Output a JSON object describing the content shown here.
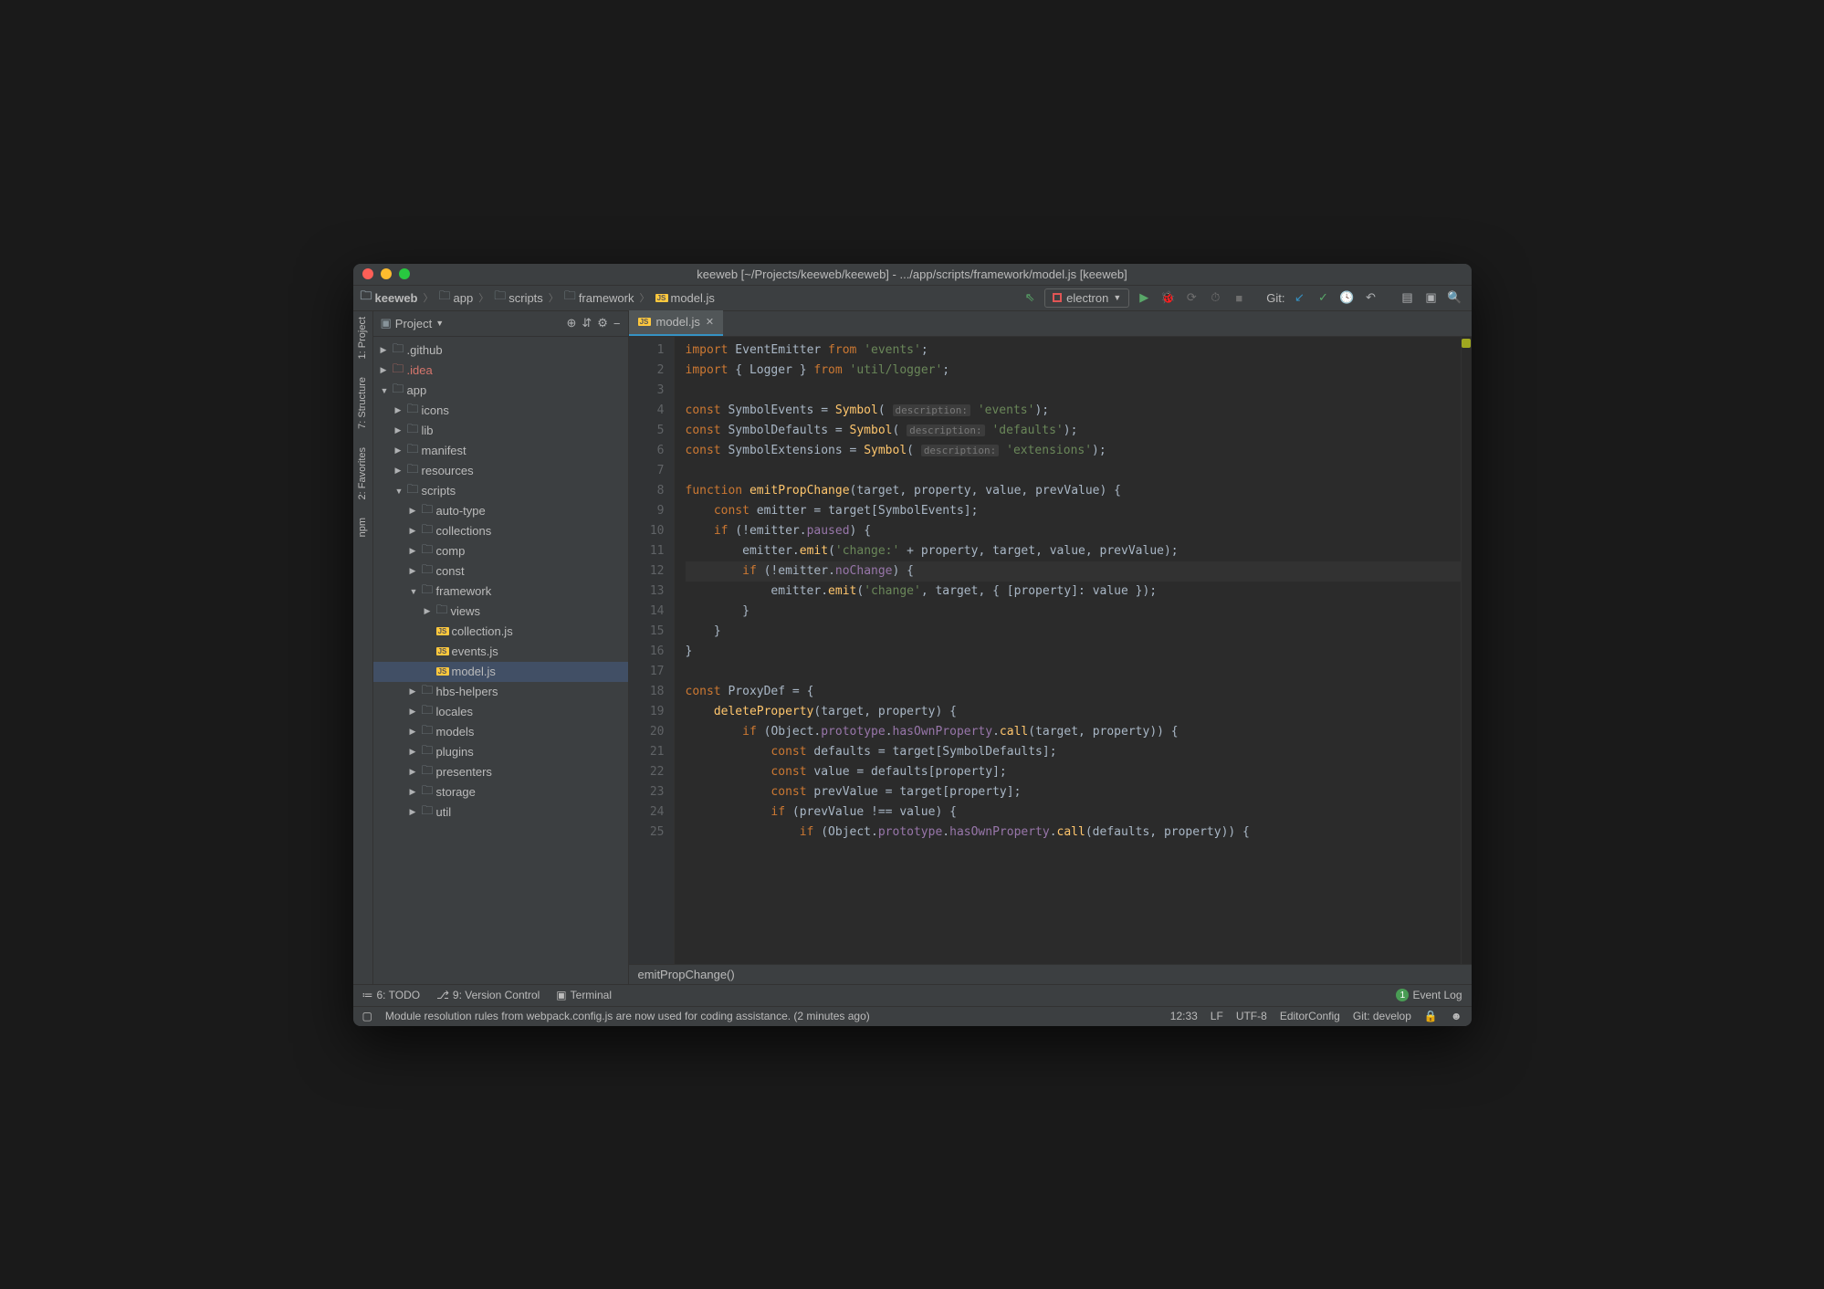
{
  "window": {
    "title": "keeweb [~/Projects/keeweb/keeweb] - .../app/scripts/framework/model.js [keeweb]"
  },
  "breadcrumbs": [
    {
      "label": "keeweb",
      "bold": true
    },
    {
      "label": "app"
    },
    {
      "label": "scripts"
    },
    {
      "label": "framework"
    },
    {
      "label": "model.js",
      "js": true
    }
  ],
  "toolbar": {
    "run_config": "electron",
    "git_label": "Git:"
  },
  "leftbar": [
    {
      "label": "1: Project"
    },
    {
      "label": "7: Structure"
    },
    {
      "label": "2: Favorites"
    },
    {
      "label": "npm"
    }
  ],
  "project_panel": {
    "title": "Project"
  },
  "tree": [
    {
      "depth": 0,
      "arrow": "▶",
      "icon": "folder",
      "label": ".github"
    },
    {
      "depth": 0,
      "arrow": "▶",
      "icon": "folder",
      "label": ".idea",
      "idea": true
    },
    {
      "depth": 0,
      "arrow": "▼",
      "icon": "folder",
      "label": "app"
    },
    {
      "depth": 1,
      "arrow": "▶",
      "icon": "folder",
      "label": "icons"
    },
    {
      "depth": 1,
      "arrow": "▶",
      "icon": "folder",
      "label": "lib"
    },
    {
      "depth": 1,
      "arrow": "▶",
      "icon": "folder",
      "label": "manifest"
    },
    {
      "depth": 1,
      "arrow": "▶",
      "icon": "folder",
      "label": "resources"
    },
    {
      "depth": 1,
      "arrow": "▼",
      "icon": "folder",
      "label": "scripts"
    },
    {
      "depth": 2,
      "arrow": "▶",
      "icon": "folder",
      "label": "auto-type"
    },
    {
      "depth": 2,
      "arrow": "▶",
      "icon": "folder",
      "label": "collections"
    },
    {
      "depth": 2,
      "arrow": "▶",
      "icon": "folder",
      "label": "comp"
    },
    {
      "depth": 2,
      "arrow": "▶",
      "icon": "folder",
      "label": "const"
    },
    {
      "depth": 2,
      "arrow": "▼",
      "icon": "folder",
      "label": "framework"
    },
    {
      "depth": 3,
      "arrow": "▶",
      "icon": "folder",
      "label": "views"
    },
    {
      "depth": 3,
      "arrow": "",
      "icon": "js",
      "label": "collection.js"
    },
    {
      "depth": 3,
      "arrow": "",
      "icon": "js",
      "label": "events.js"
    },
    {
      "depth": 3,
      "arrow": "",
      "icon": "js",
      "label": "model.js",
      "selected": true
    },
    {
      "depth": 2,
      "arrow": "▶",
      "icon": "folder",
      "label": "hbs-helpers"
    },
    {
      "depth": 2,
      "arrow": "▶",
      "icon": "folder",
      "label": "locales"
    },
    {
      "depth": 2,
      "arrow": "▶",
      "icon": "folder",
      "label": "models"
    },
    {
      "depth": 2,
      "arrow": "▶",
      "icon": "folder",
      "label": "plugins"
    },
    {
      "depth": 2,
      "arrow": "▶",
      "icon": "folder",
      "label": "presenters"
    },
    {
      "depth": 2,
      "arrow": "▶",
      "icon": "folder",
      "label": "storage"
    },
    {
      "depth": 2,
      "arrow": "▶",
      "icon": "folder",
      "label": "util"
    }
  ],
  "tabs": [
    {
      "label": "model.js"
    }
  ],
  "editor": {
    "lines": [
      {
        "n": 1,
        "h": "<span class='imp'>import</span> <span class='type'>EventEmitter</span> <span class='imp'>from</span> <span class='str'>'events'</span><span class='op'>;</span>"
      },
      {
        "n": 2,
        "h": "<span class='imp'>import</span> <span class='op'>{</span> <span class='type'>Logger</span> <span class='op'>}</span> <span class='imp'>from</span> <span class='str'>'util/logger'</span><span class='op'>;</span>"
      },
      {
        "n": 3,
        "h": ""
      },
      {
        "n": 4,
        "h": "<span class='kw'>const</span> <span class='id'>SymbolEvents</span> <span class='op'>=</span> <span class='fn'>Symbol</span><span class='op'>(</span> <span class='hint'>description:</span> <span class='str'>'events'</span><span class='op'>);</span>"
      },
      {
        "n": 5,
        "h": "<span class='kw'>const</span> <span class='id'>SymbolDefaults</span> <span class='op'>=</span> <span class='fn'>Symbol</span><span class='op'>(</span> <span class='hint'>description:</span> <span class='str'>'defaults'</span><span class='op'>);</span>"
      },
      {
        "n": 6,
        "h": "<span class='kw'>const</span> <span class='id'>SymbolExtensions</span> <span class='op'>=</span> <span class='fn'>Symbol</span><span class='op'>(</span> <span class='hint'>description:</span> <span class='str'>'extensions'</span><span class='op'>);</span>"
      },
      {
        "n": 7,
        "h": ""
      },
      {
        "n": 8,
        "h": "<span class='kw'>function</span> <span class='fn'>emitPropChange</span><span class='op'>(</span><span class='id'>target</span><span class='op'>,</span> <span class='id'>property</span><span class='op'>,</span> <span class='id'>value</span><span class='op'>,</span> <span class='id'>prevValue</span><span class='op'>) {</span>"
      },
      {
        "n": 9,
        "h": "    <span class='kw'>const</span> <span class='id'>emitter</span> <span class='op'>=</span> <span class='id'>target</span><span class='op'>[</span><span class='id'>SymbolEvents</span><span class='op'>];</span>"
      },
      {
        "n": 10,
        "h": "    <span class='kw'>if</span> <span class='op'>(!</span><span class='id'>emitter</span><span class='op'>.</span><span class='prop'>paused</span><span class='op'>) {</span>"
      },
      {
        "n": 11,
        "h": "        <span class='id'>emitter</span><span class='op'>.</span><span class='fn'>emit</span><span class='op'>(</span><span class='str'>'change:'</span> <span class='op'>+</span> <span class='id'>property</span><span class='op'>,</span> <span class='id'>target</span><span class='op'>,</span> <span class='id'>value</span><span class='op'>,</span> <span class='id'>prevValue</span><span class='op'>);</span>"
      },
      {
        "n": 12,
        "hl": true,
        "h": "        <span class='kw'>if</span> <span class='op'>(!</span><span class='id'>emitter</span><span class='op'>.</span><span class='prop'>noChange</span><span class='op'>) {</span>"
      },
      {
        "n": 13,
        "h": "            <span class='id'>emitter</span><span class='op'>.</span><span class='fn'>emit</span><span class='op'>(</span><span class='str'>'change'</span><span class='op'>,</span> <span class='id'>target</span><span class='op'>, {</span> <span class='op'>[</span><span class='id'>property</span><span class='op'>]:</span> <span class='id'>value</span> <span class='op'>});</span>"
      },
      {
        "n": 14,
        "h": "        <span class='op'>}</span>"
      },
      {
        "n": 15,
        "h": "    <span class='op'>}</span>"
      },
      {
        "n": 16,
        "h": "<span class='op'>}</span>"
      },
      {
        "n": 17,
        "h": ""
      },
      {
        "n": 18,
        "h": "<span class='kw'>const</span> <span class='id'>ProxyDef</span> <span class='op'>= {</span>"
      },
      {
        "n": 19,
        "h": "    <span class='fn'>deleteProperty</span><span class='op'>(</span><span class='id'>target</span><span class='op'>,</span> <span class='id'>property</span><span class='op'>) {</span>"
      },
      {
        "n": 20,
        "h": "        <span class='kw'>if</span> <span class='op'>(</span><span class='id'>Object</span><span class='op'>.</span><span class='prop'>prototype</span><span class='op'>.</span><span class='prop'>hasOwnProperty</span><span class='op'>.</span><span class='fn'>call</span><span class='op'>(</span><span class='id'>target</span><span class='op'>,</span> <span class='id'>property</span><span class='op'>)) {</span>"
      },
      {
        "n": 21,
        "h": "            <span class='kw'>const</span> <span class='id'>defaults</span> <span class='op'>=</span> <span class='id'>target</span><span class='op'>[</span><span class='id'>SymbolDefaults</span><span class='op'>];</span>"
      },
      {
        "n": 22,
        "h": "            <span class='kw'>const</span> <span class='id'>value</span> <span class='op'>=</span> <span class='id'>defaults</span><span class='op'>[</span><span class='id'>property</span><span class='op'>];</span>"
      },
      {
        "n": 23,
        "h": "            <span class='kw'>const</span> <span class='id'>prevValue</span> <span class='op'>=</span> <span class='id'>target</span><span class='op'>[</span><span class='id'>property</span><span class='op'>];</span>"
      },
      {
        "n": 24,
        "h": "            <span class='kw'>if</span> <span class='op'>(</span><span class='id'>prevValue</span> <span class='op'>!==</span> <span class='id'>value</span><span class='op'>) {</span>"
      },
      {
        "n": 25,
        "h": "                <span class='kw'>if</span> <span class='op'>(</span><span class='id'>Object</span><span class='op'>.</span><span class='prop'>prototype</span><span class='op'>.</span><span class='prop'>hasOwnProperty</span><span class='op'>.</span><span class='fn'>call</span><span class='op'>(</span><span class='id'>defaults</span><span class='op'>,</span> <span class='id'>property</span><span class='op'>)) {</span>"
      }
    ],
    "breadcrumb": "emitPropChange()"
  },
  "bottombar": {
    "todo": "6: TODO",
    "vcs": "9: Version Control",
    "terminal": "Terminal",
    "eventlog": "Event Log",
    "eventlog_count": "1"
  },
  "statusbar": {
    "message": "Module resolution rules from webpack.config.js are now used for coding assistance. (2 minutes ago)",
    "pos": "12:33",
    "sep": "LF",
    "enc": "UTF-8",
    "editorconfig": "EditorConfig",
    "git": "Git: develop"
  }
}
